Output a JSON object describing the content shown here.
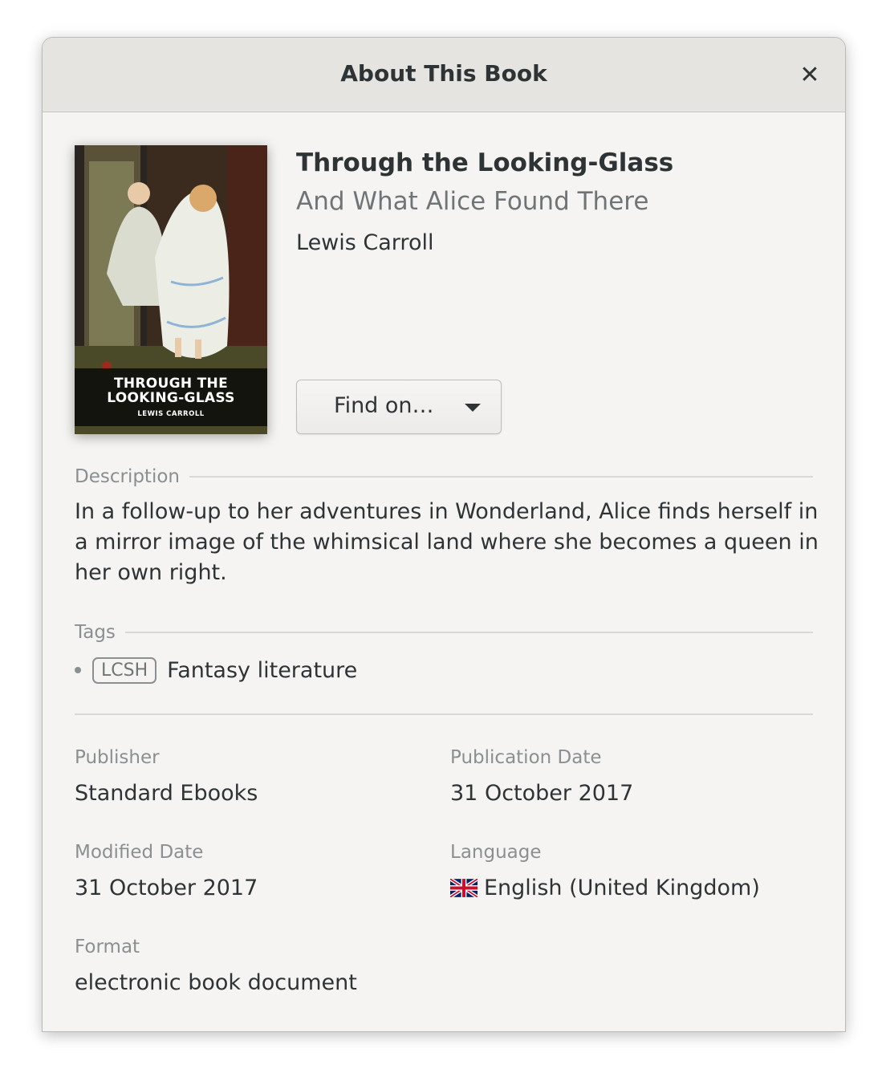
{
  "dialog": {
    "title": "About This Book",
    "close_icon": "close-icon"
  },
  "cover": {
    "title": "THROUGH THE\nLOOKING-GLASS",
    "author": "LEWIS CARROLL"
  },
  "book": {
    "title": "Through the Looking-Glass",
    "subtitle": "And What Alice Found There",
    "author": "Lewis Carroll"
  },
  "find_button": {
    "label": "Find on…",
    "icon": "chevron-down-icon"
  },
  "description": {
    "label": "Description",
    "text": "In a follow-up to her adventures in Wonderland, Alice finds herself in a mirror image of the whimsical land where she becomes a queen in her own right."
  },
  "tags": {
    "label": "Tags",
    "items": [
      {
        "badge": "LCSH",
        "text": "Fantasy literature"
      }
    ]
  },
  "fields": {
    "publisher": {
      "label": "Publisher",
      "value": "Standard Ebooks"
    },
    "publication_date": {
      "label": "Publication Date",
      "value": "31 October 2017"
    },
    "modified_date": {
      "label": "Modified Date",
      "value": "31 October 2017"
    },
    "language": {
      "label": "Language",
      "value": "English (United Kingdom)",
      "icon": "uk-flag-icon"
    },
    "format": {
      "label": "Format",
      "value": "electronic book document"
    }
  }
}
